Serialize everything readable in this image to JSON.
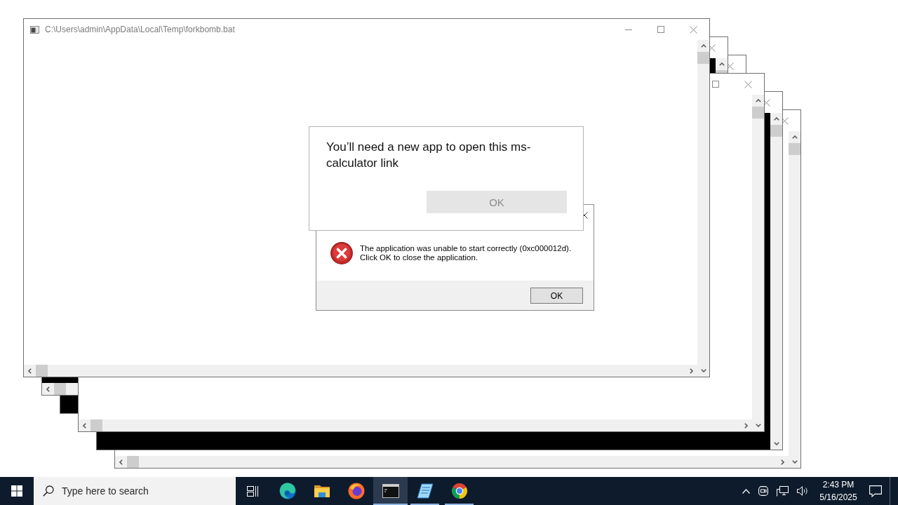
{
  "console_window": {
    "title": "C:\\Users\\admin\\AppData\\Local\\Temp\\forkbomb.bat"
  },
  "app_dialog": {
    "message": "You’ll need a new app to open this ms-calculator link",
    "button": {
      "label": "OK",
      "disabled": true
    }
  },
  "error_dialog": {
    "message": "The application was unable to start correctly (0xc000012d).\nClick OK to close the application.",
    "button": "OK"
  },
  "taskbar": {
    "search": {
      "placeholder": "Type here to search"
    },
    "apps": [
      {
        "kind": "edge",
        "selected": false,
        "running": false
      },
      {
        "kind": "explorer",
        "selected": false,
        "running": false
      },
      {
        "kind": "firefox",
        "selected": false,
        "running": false
      },
      {
        "kind": "terminal",
        "selected": true,
        "running": true
      },
      {
        "kind": "notepad",
        "selected": false,
        "running": true
      },
      {
        "kind": "chrome",
        "selected": false,
        "running": true
      }
    ],
    "clock": {
      "time": "2:43 PM",
      "date": "5/16/2025"
    }
  }
}
